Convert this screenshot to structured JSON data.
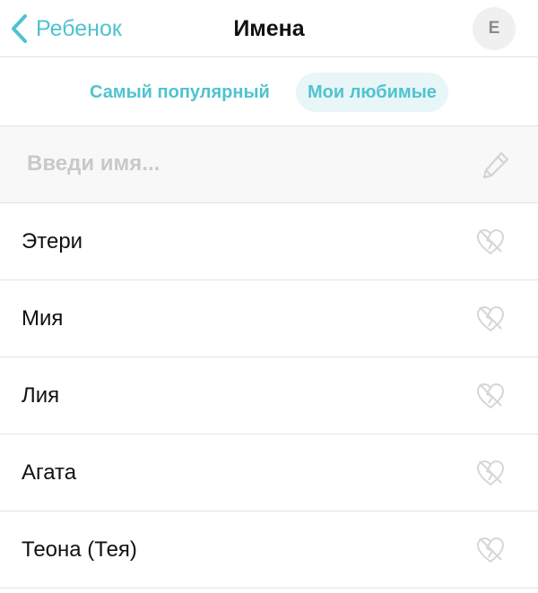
{
  "header": {
    "back_label": "Ребенок",
    "title": "Имена",
    "avatar_initial": "E",
    "back_icon": "chevron-left-icon"
  },
  "tabs": [
    {
      "label": "Самый популярный",
      "active": false
    },
    {
      "label": "Мои любимые",
      "active": true
    }
  ],
  "name_input": {
    "placeholder": "Введи имя...",
    "value": "",
    "icon": "pencil-icon"
  },
  "favorites": [
    {
      "name": "Этери"
    },
    {
      "name": "Мия"
    },
    {
      "name": "Лия"
    },
    {
      "name": "Агата"
    },
    {
      "name": "Теона (Тея)"
    }
  ],
  "item_icon": "broken-heart-icon",
  "colors": {
    "accent": "#4fc3cf",
    "active_tab_bg": "#e8f6f8",
    "divider": "#e3e3e3",
    "icon_muted": "#d6d6d6",
    "input_bg": "#f8f8f8"
  }
}
